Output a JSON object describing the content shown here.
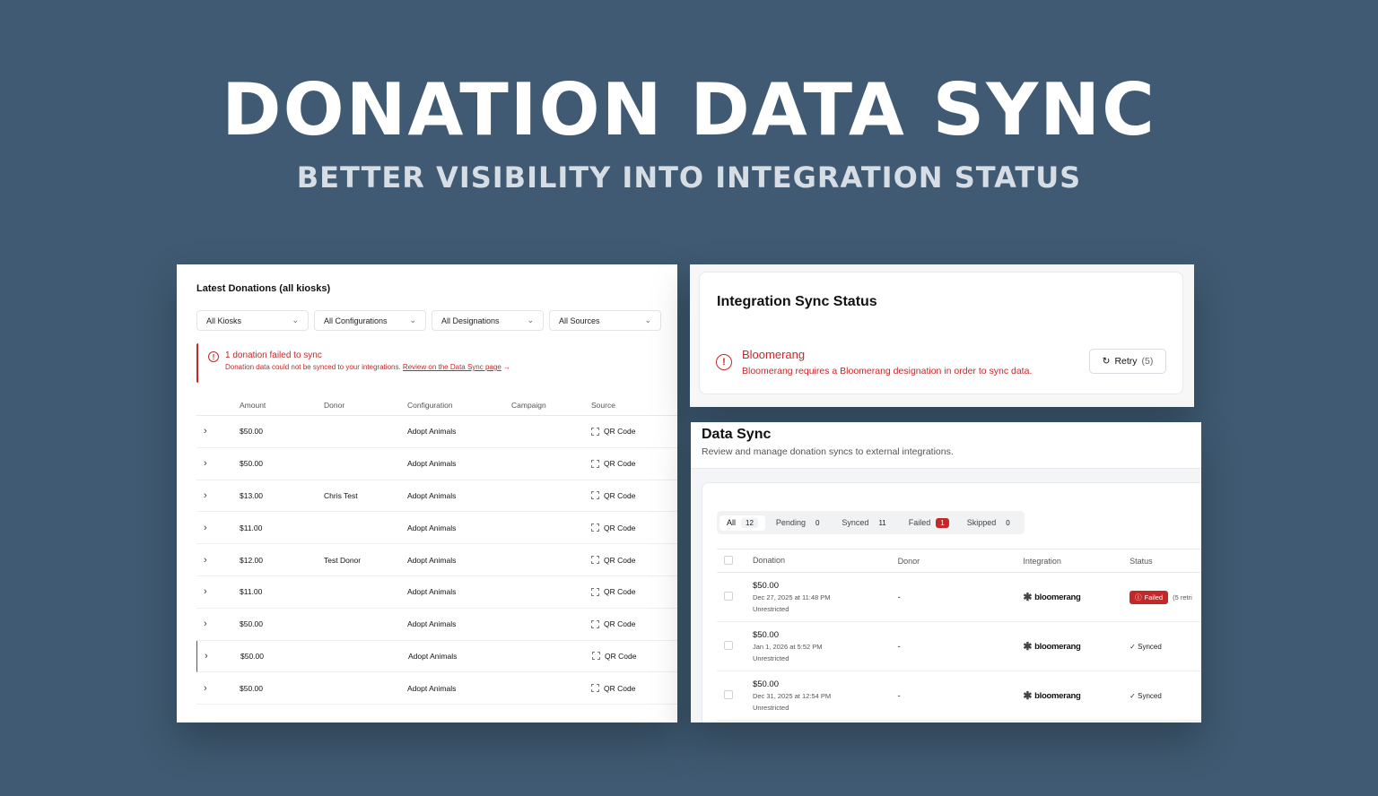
{
  "hero": {
    "title": "DONATION DATA SYNC",
    "subtitle": "BETTER VISIBILITY INTO INTEGRATION STATUS"
  },
  "donations_panel": {
    "title": "Latest Donations (all kiosks)",
    "filters": [
      "All Kiosks",
      "All Configurations",
      "All Designations",
      "All Sources"
    ],
    "alert": {
      "title": "1 donation failed to sync",
      "description": "Donation data could not be synced to your integrations.",
      "link": "Review on the Data Sync page",
      "arrow": "→"
    },
    "columns": [
      "Amount",
      "Donor",
      "Configuration",
      "Campaign",
      "Source"
    ],
    "rows": [
      {
        "amount": "$50.00",
        "donor": "",
        "configuration": "Adopt Animals",
        "campaign": "",
        "source": "QR Code"
      },
      {
        "amount": "$50.00",
        "donor": "",
        "configuration": "Adopt Animals",
        "campaign": "",
        "source": "QR Code"
      },
      {
        "amount": "$13.00",
        "donor": "Chris Test",
        "configuration": "Adopt Animals",
        "campaign": "",
        "source": "QR Code"
      },
      {
        "amount": "$11.00",
        "donor": "",
        "configuration": "Adopt Animals",
        "campaign": "",
        "source": "QR Code"
      },
      {
        "amount": "$12.00",
        "donor": "Test Donor",
        "configuration": "Adopt Animals",
        "campaign": "",
        "source": "QR Code"
      },
      {
        "amount": "$11.00",
        "donor": "",
        "configuration": "Adopt Animals",
        "campaign": "",
        "source": "QR Code"
      },
      {
        "amount": "$50.00",
        "donor": "",
        "configuration": "Adopt Animals",
        "campaign": "",
        "source": "QR Code"
      },
      {
        "amount": "$50.00",
        "donor": "",
        "configuration": "Adopt Animals",
        "campaign": "",
        "source": "QR Code"
      },
      {
        "amount": "$50.00",
        "donor": "",
        "configuration": "Adopt Animals",
        "campaign": "",
        "source": "QR Code"
      }
    ]
  },
  "sync_status": {
    "title": "Integration Sync Status",
    "integration": "Bloomerang",
    "message": "Bloomerang requires a Bloomerang designation in order to sync data.",
    "retry_label": "Retry",
    "retry_count": "(5)"
  },
  "data_sync": {
    "title": "Data Sync",
    "subtitle": "Review and manage donation syncs to external integrations.",
    "tabs": [
      {
        "label": "All",
        "count": "12"
      },
      {
        "label": "Pending",
        "count": "0"
      },
      {
        "label": "Synced",
        "count": "11"
      },
      {
        "label": "Failed",
        "count": "1"
      },
      {
        "label": "Skipped",
        "count": "0"
      }
    ],
    "columns": [
      "Donation",
      "Donor",
      "Integration",
      "Status"
    ],
    "rows": [
      {
        "amount": "$50.00",
        "date": "Dec 27, 2025 at 11:48 PM",
        "designation": "Unrestricted",
        "donor": "-",
        "integration": "bloomerang",
        "status": "Failed",
        "retries": "(5 retri"
      },
      {
        "amount": "$50.00",
        "date": "Jan 1, 2026 at 5:52 PM",
        "designation": "Unrestricted",
        "donor": "-",
        "integration": "bloomerang",
        "status": "Synced"
      },
      {
        "amount": "$50.00",
        "date": "Dec 31, 2025 at 12:54 PM",
        "designation": "Unrestricted",
        "donor": "-",
        "integration": "bloomerang",
        "status": "Synced"
      }
    ]
  },
  "colors": {
    "background": "#3f5a72",
    "error": "#c62828"
  }
}
